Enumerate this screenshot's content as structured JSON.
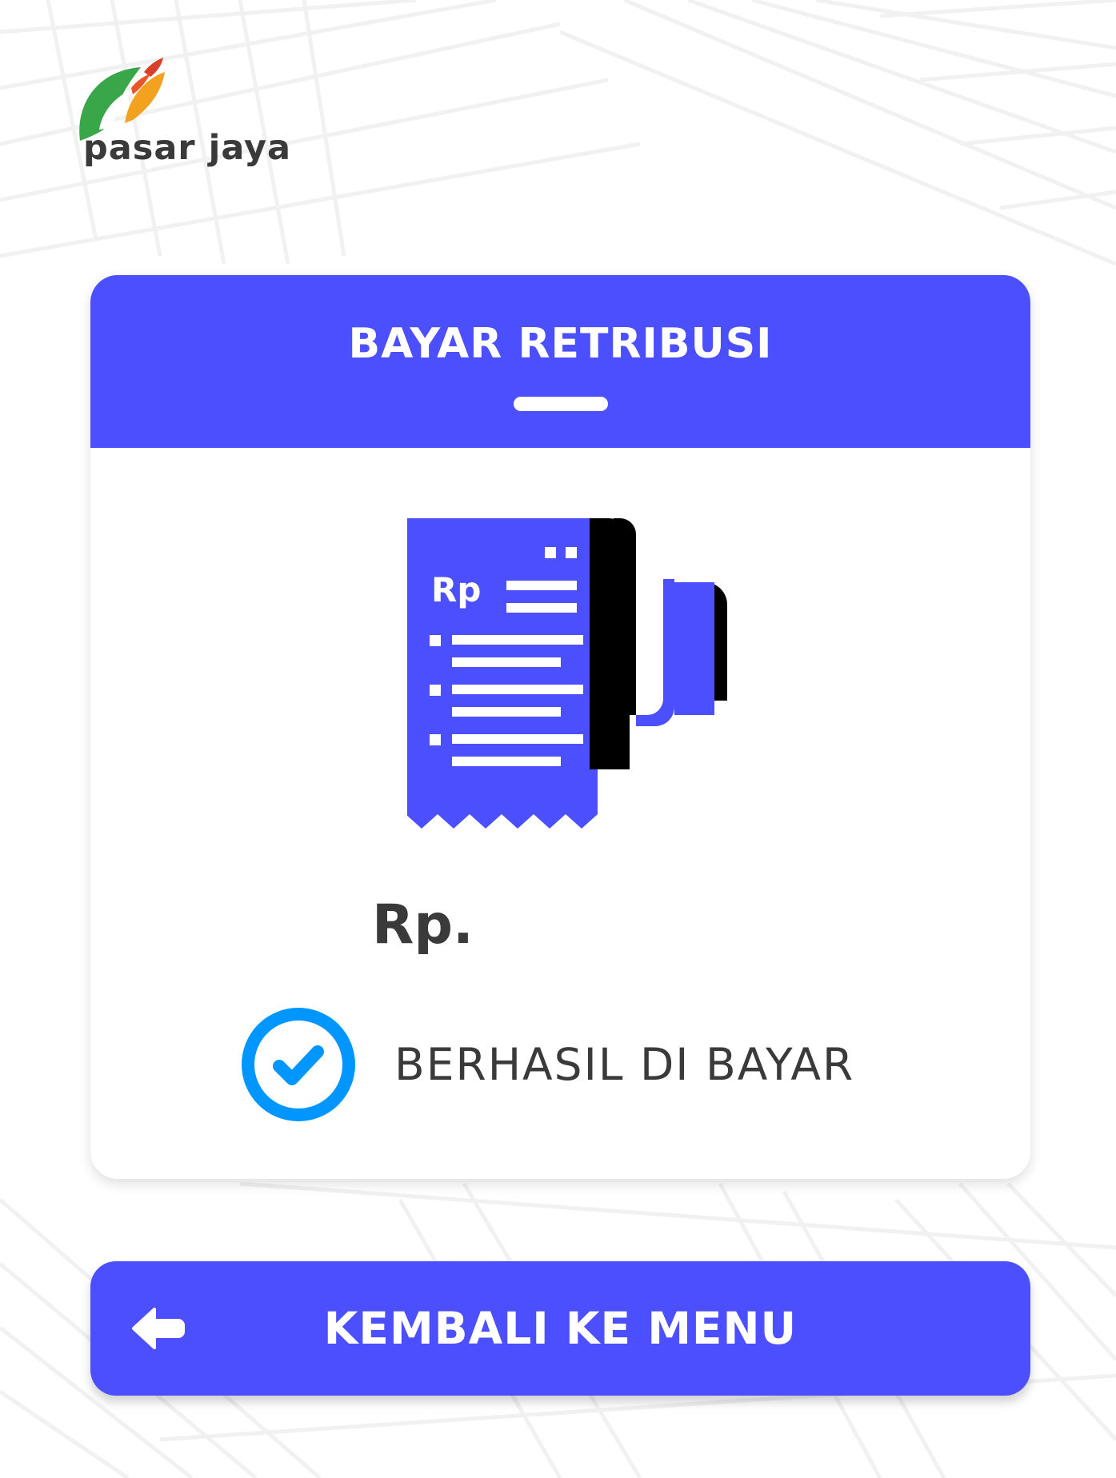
{
  "brand": {
    "name": "pasar jaya",
    "colors": {
      "leaf_green": "#3aa64a",
      "leaf_orange": "#f2a21f",
      "leaf_red": "#d9402b"
    }
  },
  "card": {
    "title": "BAYAR RETRIBUSI",
    "illustration": "receipt-icon",
    "receipt_label": "Rp",
    "amount": "Rp.",
    "status_text": "BERHASIL DI BAYAR",
    "status_icon": "check-circle-icon"
  },
  "back_button": {
    "label": "KEMBALI KE MENU",
    "icon": "arrow-left-icon"
  },
  "colors": {
    "primary": "#4b4ffe",
    "success": "#0096ff",
    "text": "#3a3a3a"
  }
}
